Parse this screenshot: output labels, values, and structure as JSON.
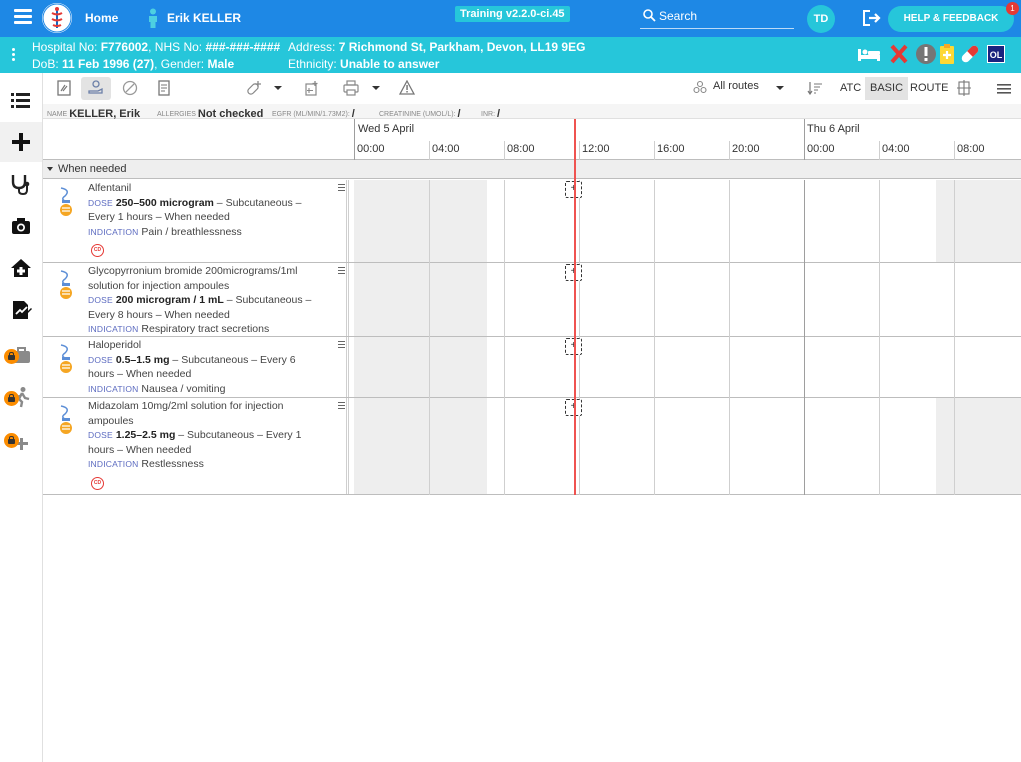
{
  "topbar": {
    "home_label": "Home",
    "user_name": "Erik KELLER",
    "environment": "Training v2.2.0-ci.45",
    "search_label": "Search",
    "user_initials": "TD",
    "help_label": "HELP & FEEDBACK",
    "notification_count": "1"
  },
  "banner": {
    "hospital_no_label": "Hospital No:",
    "hospital_no": "F776002",
    "nhs_no_label": "NHS No:",
    "nhs_no": "###-###-####",
    "address_label": "Address:",
    "address": "7 Richmond St, Parkham, Devon, LL19 9EG",
    "dob_label": "DoB:",
    "dob": "11 Feb 1996 (27)",
    "gender_label": "Gender:",
    "gender": "Male",
    "ethnicity_label": "Ethnicity:",
    "ethnicity": "Unable to answer",
    "ol_badge": "OL"
  },
  "toolbar": {
    "routes_label": "All routes",
    "atc_label": "ATC",
    "basic_label": "BASIC",
    "route_label": "ROUTE"
  },
  "infostrip": {
    "name_label": "NAME",
    "name": "KELLER, Erik",
    "allergies_label": "ALLERGIES",
    "allergies": "Not checked",
    "egfr_label": "EGFR (ML/MIN/1.73M2)",
    "egfr": "/",
    "creatinine_label": "CREATININE (UMOL/L)",
    "creatinine": "/",
    "inr_label": "INR",
    "inr": "/"
  },
  "timeline": {
    "days": [
      "Wed 5 April",
      "Thu 6 April"
    ],
    "hours": [
      "00:00",
      "04:00",
      "08:00",
      "12:00",
      "16:00",
      "20:00",
      "00:00",
      "04:00",
      "08:00"
    ]
  },
  "group": {
    "label": "When needed"
  },
  "labels": {
    "dose": "DOSE",
    "indication": "INDICATION",
    "cd": "CD",
    "add": "+"
  },
  "medications": [
    {
      "name": "Alfentanil",
      "dose": "250–500 microgram",
      "regimen_a": " – Subcutaneous –",
      "regimen_b": "Every 1 hours – When needed",
      "indication": "Pain / breathlessness",
      "controlled": true
    },
    {
      "name_a": "Glycopyrronium bromide 200micrograms/1ml",
      "name_b": "solution for injection ampoules",
      "dose": "200 microgram / 1 mL",
      "regimen_a": " – Subcutaneous –",
      "regimen_b": "Every 8 hours – When needed",
      "indication": "Respiratory tract secretions",
      "controlled": false
    },
    {
      "name": "Haloperidol",
      "dose": "0.5–1.5 mg",
      "regimen_a": " – Subcutaneous – Every 6",
      "regimen_b": "hours – When needed",
      "indication": "Nausea / vomiting",
      "controlled": false
    },
    {
      "name_a": "Midazolam 10mg/2ml solution for injection",
      "name_b": "ampoules",
      "dose": "1.25–2.5 mg",
      "regimen_a": " – Subcutaneous – Every 1",
      "regimen_b": "hours – When needed",
      "indication": "Restlessness",
      "controlled": true
    }
  ],
  "colors": {
    "topbar": "#1e88e5",
    "banner": "#26c6da",
    "now_line": "#ef5350",
    "alert_red": "#e53935",
    "lock_orange": "#fb8c00"
  }
}
